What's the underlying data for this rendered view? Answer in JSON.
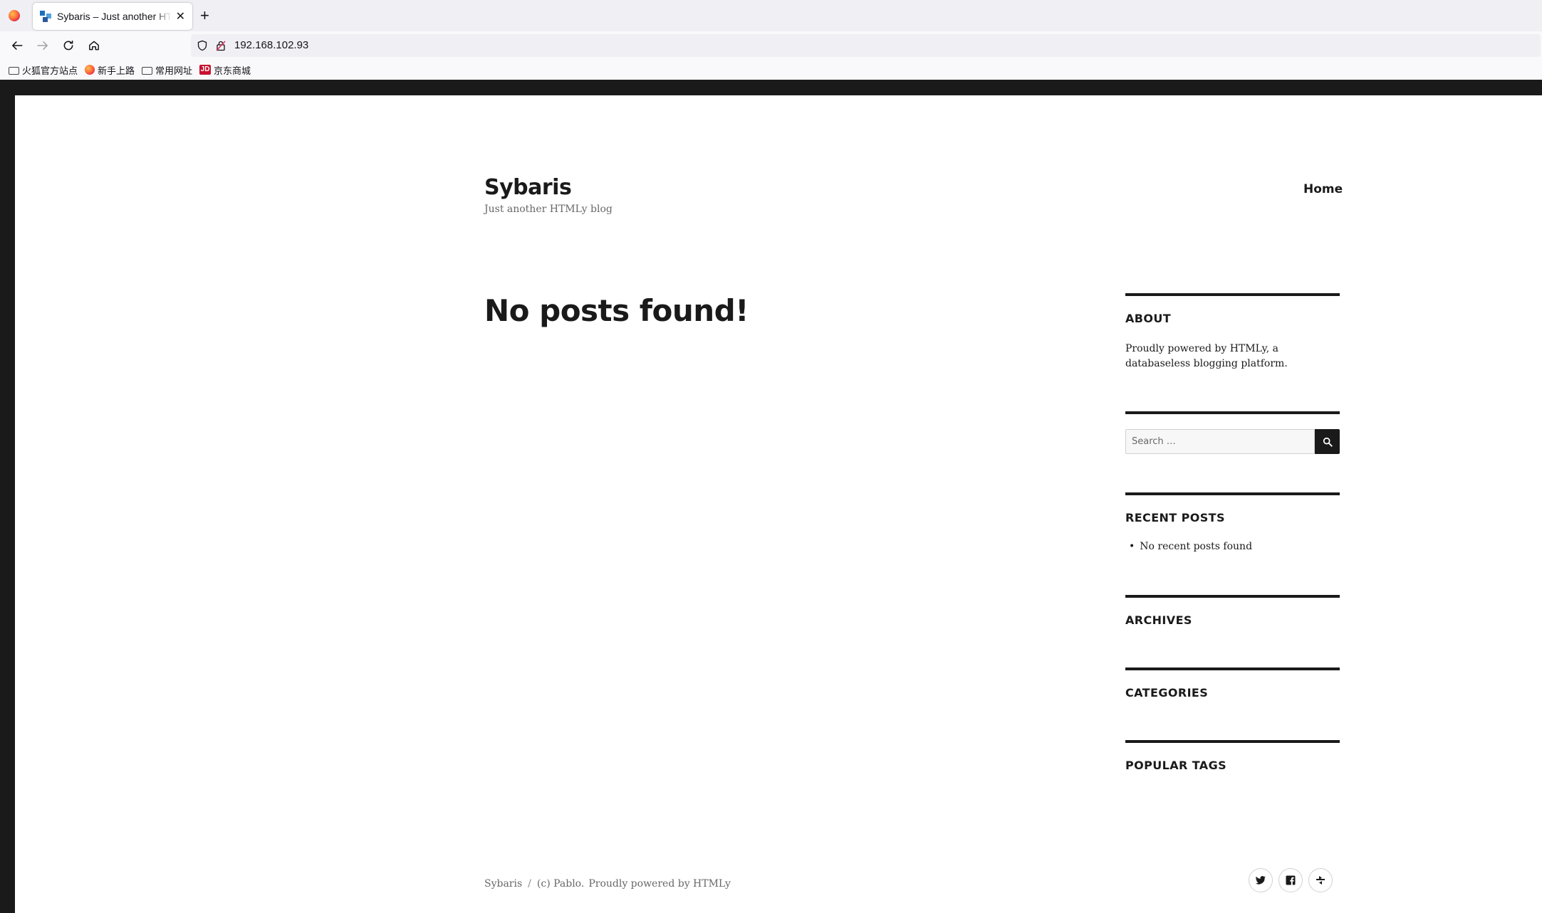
{
  "browser": {
    "tab_title": "Sybaris – Just another HTMLy blog",
    "tab_close": "✕",
    "new_tab": "+",
    "url": "192.168.102.93",
    "bookmarks": [
      {
        "label": "火狐官方站点",
        "icon": "folder-icon"
      },
      {
        "label": "新手上路",
        "icon": "firefox-icon"
      },
      {
        "label": "常用网址",
        "icon": "folder-icon"
      },
      {
        "label": "京东商城",
        "icon": "jd-icon"
      }
    ],
    "jd_icon_text": "JD"
  },
  "site": {
    "title": "Sybaris",
    "description": "Just another HTMLy blog",
    "nav": [
      "Home"
    ]
  },
  "main": {
    "heading": "No posts found!"
  },
  "sidebar": {
    "about_title": "ABOUT",
    "about_text": "Proudly powered by HTMLy, a databaseless blogging platform.",
    "search_placeholder": "Search …",
    "recent_title": "RECENT POSTS",
    "recent_items": [
      "No recent posts found"
    ],
    "archives_title": "ARCHIVES",
    "categories_title": "CATEGORIES",
    "tags_title": "POPULAR TAGS"
  },
  "footer": {
    "site": "Sybaris",
    "separator": "/",
    "copyright": "(c) Pablo.",
    "powered": "Proudly powered by HTMLy",
    "social_icons": [
      "twitter-icon",
      "facebook-icon",
      "rss-icon"
    ]
  },
  "colors": {
    "text": "#1a1a1a",
    "muted": "#686868",
    "page_border": "#1a1a1a"
  }
}
